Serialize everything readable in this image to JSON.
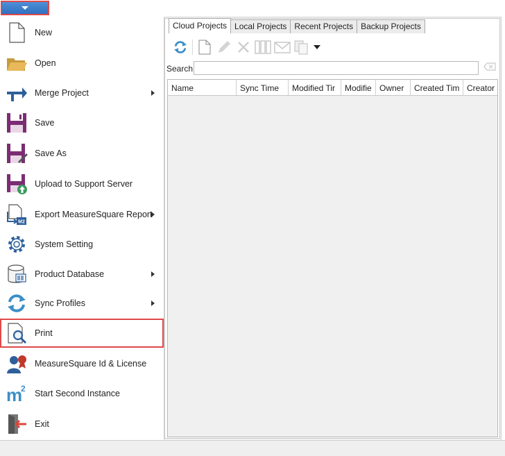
{
  "menu": {
    "items": [
      {
        "label": "New",
        "icon": "new-document-icon",
        "has_submenu": false
      },
      {
        "label": "Open",
        "icon": "open-folder-icon",
        "has_submenu": false
      },
      {
        "label": "Merge Project",
        "icon": "merge-arrow-icon",
        "has_submenu": true
      },
      {
        "label": "Save",
        "icon": "save-icon",
        "has_submenu": false
      },
      {
        "label": "Save As",
        "icon": "save-as-icon",
        "has_submenu": false
      },
      {
        "label": "Upload to Support Server",
        "icon": "upload-save-icon",
        "has_submenu": false
      },
      {
        "label": "Export MeasureSquare Report",
        "icon": "export-report-icon",
        "has_submenu": true
      },
      {
        "label": "System Setting",
        "icon": "gear-icon",
        "has_submenu": false
      },
      {
        "label": "Product Database",
        "icon": "database-icon",
        "has_submenu": true
      },
      {
        "label": "Sync Profiles",
        "icon": "sync-icon",
        "has_submenu": true
      },
      {
        "label": "Print",
        "icon": "print-preview-icon",
        "has_submenu": false
      },
      {
        "label": "MeasureSquare Id & License",
        "icon": "license-user-icon",
        "has_submenu": false
      },
      {
        "label": "Start Second Instance",
        "icon": "m2-icon",
        "has_submenu": false
      },
      {
        "label": "Exit",
        "icon": "exit-door-icon",
        "has_submenu": false
      }
    ]
  },
  "tabs": [
    "Cloud Projects",
    "Local Projects",
    "Recent Projects",
    "Backup Projects"
  ],
  "toolbar": {
    "icons": [
      "refresh-icon",
      "new-file-icon",
      "edit-pencil-icon",
      "delete-x-icon",
      "columns-icon",
      "email-icon",
      "copy-icon",
      "dropdown-arrow-icon"
    ]
  },
  "search": {
    "label": "Search",
    "value": ""
  },
  "grid": {
    "columns": [
      "Name",
      "Sync Time",
      "Modified Tir",
      "Modifie",
      "Owner",
      "Created Tim",
      "Creator"
    ]
  },
  "m2_icon_text": {
    "base": "m",
    "sup": "2"
  },
  "export_badge": "M2",
  "colors": {
    "accent": "#2f6fc0",
    "highlight_border": "#e04848",
    "grid_bg": "#f0f0f0"
  }
}
